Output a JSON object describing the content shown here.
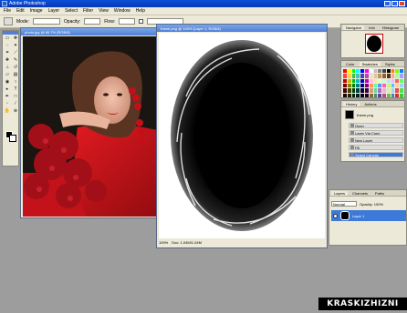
{
  "app": {
    "title": "Adobe Photoshop",
    "icon": "photoshop-icon"
  },
  "menu": [
    "File",
    "Edit",
    "Image",
    "Layer",
    "Select",
    "Filter",
    "View",
    "Window",
    "Help"
  ],
  "options": {
    "mode_label": "Mode:",
    "opacity_label": "Opacity:",
    "flow_label": "Flow:"
  },
  "photo_doc": {
    "title": "photo.jpg @ 66.7% (RGB/8)"
  },
  "frame_doc": {
    "title": "frame.png @ 100% (Layer 1, RGB/8)",
    "status_zoom": "100%",
    "status_doc": "Doc: 1.04M/1.04M"
  },
  "navigator": {
    "tabs": [
      "Navigator",
      "Info",
      "Histogram"
    ]
  },
  "swatches": {
    "tabs": [
      "Color",
      "Swatches",
      "Styles"
    ],
    "colors": [
      "#ff0000",
      "#ffff00",
      "#00ff00",
      "#00ffff",
      "#0000ff",
      "#ff00ff",
      "#ffffff",
      "#c0c0c0",
      "#808080",
      "#404040",
      "#000000",
      "#ff8000",
      "#80ff00",
      "#0080ff",
      "#ff4040",
      "#ffd040",
      "#40c040",
      "#40c0c0",
      "#4040c0",
      "#c040c0",
      "#f0e0c0",
      "#e0c0a0",
      "#c09060",
      "#906030",
      "#603010",
      "#ffa0a0",
      "#a0ffa0",
      "#a0a0ff",
      "#c00000",
      "#c0c000",
      "#00c000",
      "#00c0c0",
      "#0000c0",
      "#c000c0",
      "#ffc0e0",
      "#ffe0c0",
      "#e0ffc0",
      "#c0ffe0",
      "#c0e0ff",
      "#e0c0ff",
      "#ff6060",
      "#60ff60",
      "#800000",
      "#808000",
      "#008000",
      "#008080",
      "#000080",
      "#800080",
      "#ff9060",
      "#60ff90",
      "#6090ff",
      "#ff60c0",
      "#c0ff60",
      "#60c0ff",
      "#ffd0a0",
      "#a0d0ff",
      "#400000",
      "#404000",
      "#004000",
      "#004040",
      "#000040",
      "#400040",
      "#d0a070",
      "#70d0a0",
      "#a070d0",
      "#f0b0d0",
      "#d0f0b0",
      "#b0d0f0",
      "#e05050",
      "#50e050",
      "#200000",
      "#202000",
      "#002000",
      "#002020",
      "#000020",
      "#200020",
      "#906040",
      "#409060",
      "#604090",
      "#b05080",
      "#80b050",
      "#5080b0",
      "#d03030",
      "#30d030"
    ]
  },
  "history": {
    "tabs": [
      "History",
      "Actions"
    ],
    "snapshot": "frame.png",
    "steps": [
      "Open",
      "Layer Via Copy",
      "New Layer",
      "Fill",
      "Select Canvas"
    ]
  },
  "layers": {
    "tabs": [
      "Layers",
      "Channels",
      "Paths"
    ],
    "blend": "Normal",
    "opacity": "Opacity: 100%",
    "layer_name": "Layer 1"
  },
  "watermark": "KRASKIZHIZNI",
  "colors": {
    "title_blue": "#0a4fd6",
    "chrome": "#ece9d8",
    "workspace": "#9d9d9d",
    "selection_blue": "#3d79d8"
  }
}
